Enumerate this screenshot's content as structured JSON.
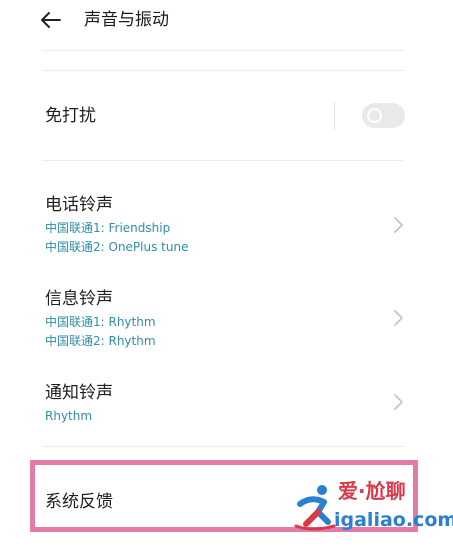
{
  "header": {
    "title": "声音与振动"
  },
  "do_not_disturb": {
    "label": "免打扰",
    "toggle_on": false
  },
  "ringtone": {
    "label": "电话铃声",
    "sim1": "中国联通1: Friendship",
    "sim2": "中国联通2: OnePlus tune"
  },
  "message_tone": {
    "label": "信息铃声",
    "sim1": "中国联通1: Rhythm",
    "sim2": "中国联通2: Rhythm"
  },
  "notification_tone": {
    "label": "通知铃声",
    "value": "Rhythm"
  },
  "system_feedback": {
    "label": "系统反馈"
  },
  "watermark": {
    "top_text": "爱·尬聊",
    "bottom_text": "igaliao.com"
  },
  "colors": {
    "subtitle": "#2f8fa6",
    "highlight_border": "#e27ba6",
    "watermark_red": "#d93a4b",
    "watermark_blue": "#2b7fd0"
  }
}
